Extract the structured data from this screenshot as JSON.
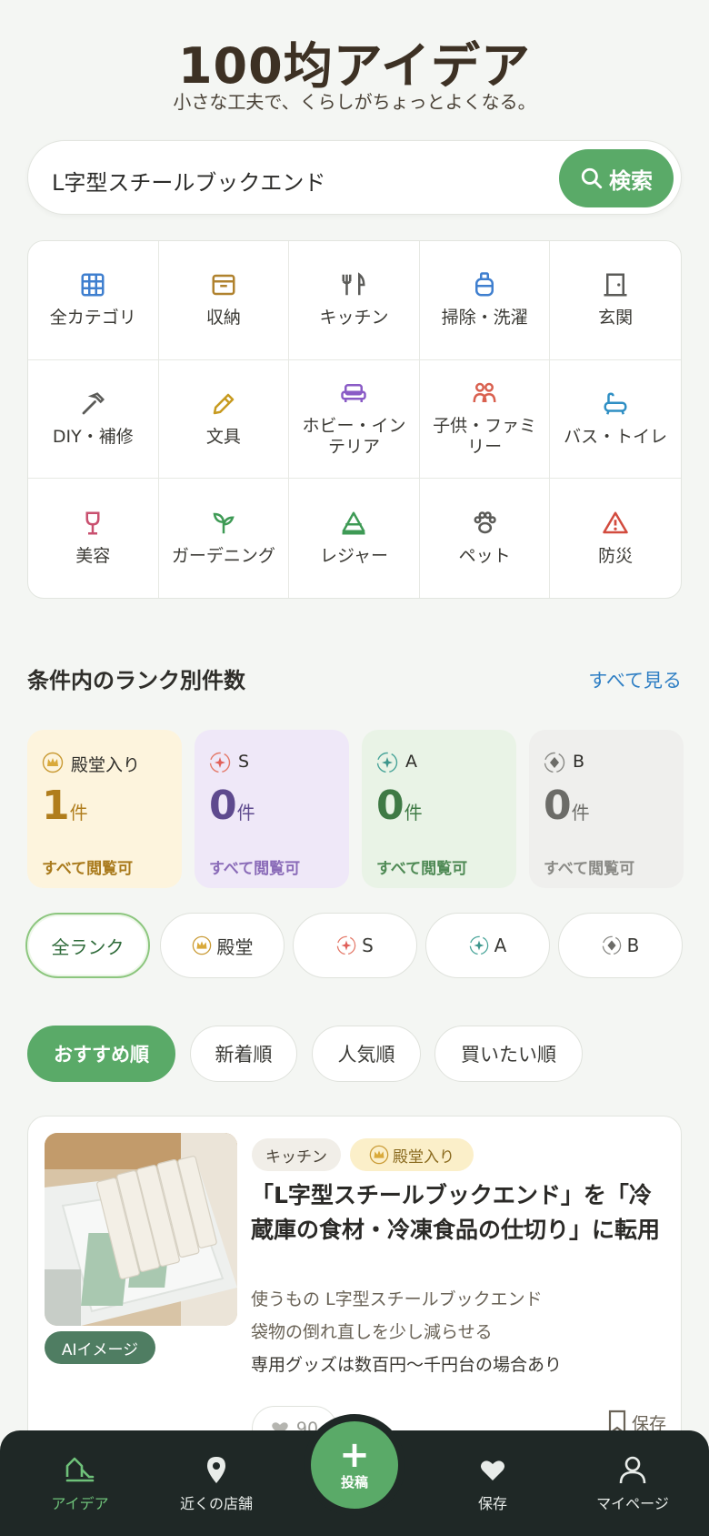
{
  "header": {
    "title": "100均アイデア",
    "subtitle": "小さな工夫で、くらしがちょっとよくなる。"
  },
  "search": {
    "value": "L字型スチールブックエンド",
    "button_label": "検索"
  },
  "categories": [
    {
      "label": "全カテゴリ",
      "icon": "grid-icon",
      "color": "#3f7fcf"
    },
    {
      "label": "収納",
      "icon": "box-icon",
      "color": "#b0822e"
    },
    {
      "label": "キッチン",
      "icon": "fork-knife-icon",
      "color": "#5b5b58"
    },
    {
      "label": "掃除・洗濯",
      "icon": "bucket-icon",
      "color": "#3f7fcf"
    },
    {
      "label": "玄関",
      "icon": "door-icon",
      "color": "#5b5b58"
    },
    {
      "label": "DIY・補修",
      "icon": "hammer-icon",
      "color": "#5b5b58"
    },
    {
      "label": "文具",
      "icon": "pencil-icon",
      "color": "#c79a1f"
    },
    {
      "label": "ホビー・インテリア",
      "icon": "sofa-icon",
      "color": "#8a5bc6"
    },
    {
      "label": "子供・ファミリー",
      "icon": "family-icon",
      "color": "#d9604f"
    },
    {
      "label": "バス・トイレ",
      "icon": "bathtub-icon",
      "color": "#2f8fc4"
    },
    {
      "label": "美容",
      "icon": "wine-glass-icon",
      "color": "#c9506f"
    },
    {
      "label": "ガーデニング",
      "icon": "sprout-icon",
      "color": "#3e9a55"
    },
    {
      "label": "レジャー",
      "icon": "tent-icon",
      "color": "#3e9a55"
    },
    {
      "label": "ペット",
      "icon": "paw-icon",
      "color": "#5b5b58"
    },
    {
      "label": "防災",
      "icon": "warning-icon",
      "color": "#d24b3e"
    }
  ],
  "rank_section": {
    "heading": "条件内のランク別件数",
    "see_all": "すべて見る",
    "cards": [
      {
        "label": "殿堂入り",
        "count": "1",
        "unit": "件",
        "foot": "すべて閲覧可",
        "icon": "crown-icon",
        "bg": "#fdf4dd",
        "color": "#b07d1c"
      },
      {
        "label": "S",
        "count": "0",
        "unit": "件",
        "foot": "すべて閲覧可",
        "icon": "s-rank-icon",
        "bg": "#efe8f8",
        "color": "#5e4a8e"
      },
      {
        "label": "A",
        "count": "0",
        "unit": "件",
        "foot": "すべて閲覧可",
        "icon": "a-rank-icon",
        "bg": "#e9f3e6",
        "color": "#3f7a45"
      },
      {
        "label": "B",
        "count": "0",
        "unit": "件",
        "foot": "すべて閲覧可",
        "icon": "b-rank-icon",
        "bg": "#efefed",
        "color": "#6c6c68"
      }
    ]
  },
  "rank_filters": [
    "全ランク",
    "殿堂",
    "S",
    "A",
    "B"
  ],
  "sort_options": [
    "おすすめ順",
    "新着順",
    "人気順",
    "買いたい順"
  ],
  "idea_card": {
    "ai_badge": "AIイメージ",
    "tag_category": "キッチン",
    "tag_rank": "殿堂入り",
    "title": "「L字型スチールブックエンド」を「冷蔵庫の食材・冷凍食品の仕切り」に転用",
    "uses": "使うもの L字型スチールブックエンド",
    "benefit": "袋物の倒れ直しを少し減らせる",
    "note": "専用グッズは数百円〜千円台の場合あり",
    "likes": "90",
    "save_label": "保存"
  },
  "nav": {
    "ideas": "アイデア",
    "stores": "近くの店舗",
    "post": "投稿",
    "saved": "保存",
    "mypage": "マイページ"
  }
}
